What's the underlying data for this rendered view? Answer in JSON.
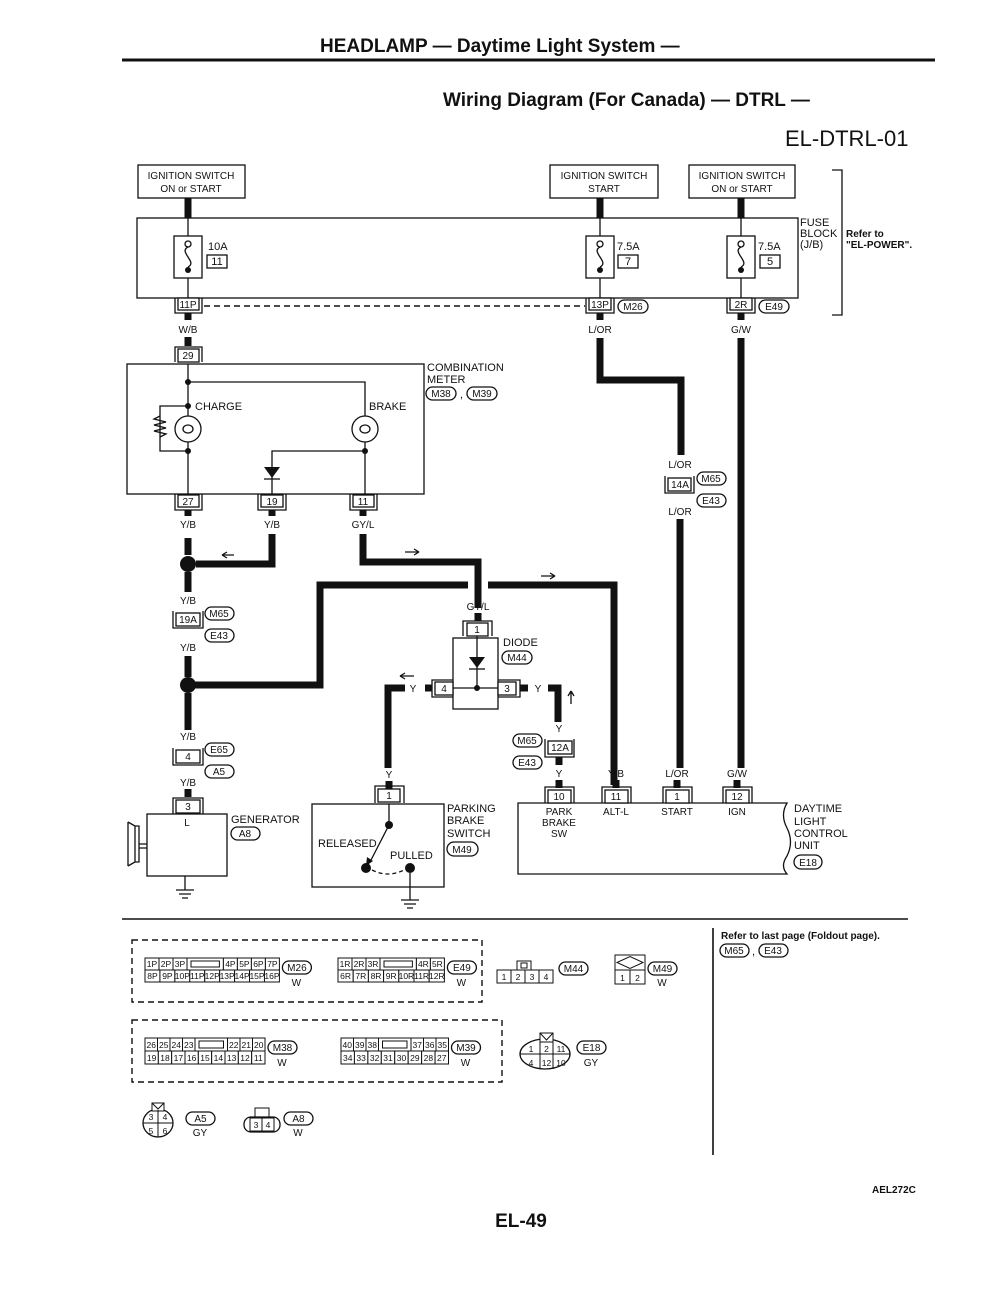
{
  "header": {
    "title": "HEADLAMP — Daytime Light System —",
    "subtitle": "Wiring Diagram (For Canada) — DTRL —",
    "diagram_code": "EL-DTRL-01"
  },
  "power_sources": [
    {
      "line1": "IGNITION SWITCH",
      "line2": "ON or START"
    },
    {
      "line1": "IGNITION SWITCH",
      "line2": "START"
    },
    {
      "line1": "IGNITION SWITCH",
      "line2": "ON or START"
    }
  ],
  "fuse_block": {
    "label_lines": [
      "FUSE",
      "BLOCK",
      "(J/B)"
    ],
    "refer_lines": [
      "Refer to",
      "\"EL-POWER\"."
    ],
    "fuses": [
      {
        "rating": "10A",
        "number": "11",
        "terminal": "11P",
        "connector": "",
        "wire": "W/B"
      },
      {
        "rating": "7.5A",
        "number": "7",
        "terminal": "13P",
        "connector": "M26",
        "wire": "L/OR"
      },
      {
        "rating": "7.5A",
        "number": "5",
        "terminal": "2R",
        "connector": "E49",
        "wire": "G/W"
      }
    ]
  },
  "combination_meter": {
    "label_lines": [
      "COMBINATION",
      "METER"
    ],
    "connectors": [
      "M38",
      "M39"
    ],
    "comma": ",",
    "input_terminal": "29",
    "lamps": [
      "CHARGE",
      "BRAKE"
    ],
    "terminals": [
      {
        "num": "27",
        "wire": "Y/B"
      },
      {
        "num": "19",
        "wire": "Y/B"
      },
      {
        "num": "11",
        "wire": "GY/L"
      }
    ]
  },
  "joint_connectors": {
    "c19a": {
      "terminal": "19A",
      "wire_top": "Y/B",
      "wire_bottom": "Y/B",
      "connectors": [
        "M65",
        "E43"
      ]
    },
    "c14a": {
      "terminal": "14A",
      "wire_top": "L/OR",
      "wire_bottom": "L/OR",
      "connectors": [
        "M65",
        "E43"
      ]
    },
    "c12a": {
      "terminal": "12A",
      "wire_top": "Y",
      "wire_bottom": "Y",
      "connectors": [
        "M65",
        "E43"
      ]
    },
    "c4": {
      "terminal": "4",
      "wire_top": "Y/B",
      "wire_bottom": "Y/B",
      "connectors": [
        "E65",
        "A5"
      ]
    }
  },
  "diode": {
    "label": "DIODE",
    "connector": "M44",
    "wire_in": "GY/L",
    "pins": {
      "top": "1",
      "left": "4",
      "right": "3"
    },
    "wire_left": "Y",
    "wire_right": "Y"
  },
  "generator": {
    "label": "GENERATOR",
    "connector": "A8",
    "terminal": "3",
    "terminal_name": "L"
  },
  "parking_brake_switch": {
    "label_lines": [
      "PARKING",
      "BRAKE",
      "SWITCH"
    ],
    "connector": "M49",
    "terminal": "1",
    "wire": "Y",
    "states": [
      "RELEASED",
      "PULLED"
    ]
  },
  "control_unit": {
    "label_lines": [
      "DAYTIME",
      "LIGHT",
      "CONTROL",
      "UNIT"
    ],
    "connector": "E18",
    "terminals": [
      {
        "num": "10",
        "wire": "Y",
        "name_lines": [
          "PARK",
          "BRAKE",
          "SW"
        ]
      },
      {
        "num": "11",
        "wire": "Y/B",
        "name_lines": [
          "ALT-L"
        ]
      },
      {
        "num": "1",
        "wire": "L/OR",
        "name_lines": [
          "START"
        ]
      },
      {
        "num": "12",
        "wire": "G/W",
        "name_lines": [
          "IGN"
        ]
      }
    ]
  },
  "connector_views": {
    "m26": {
      "id": "M26",
      "color": "W",
      "top": [
        "1P",
        "2P",
        "3P",
        "",
        "4P",
        "5P",
        "6P",
        "7P"
      ],
      "bottom": [
        "8P",
        "9P",
        "10P",
        "11P",
        "12P",
        "13P",
        "14P",
        "15P",
        "16P"
      ]
    },
    "e49": {
      "id": "E49",
      "color": "W",
      "top": [
        "1R",
        "2R",
        "3R",
        "",
        "4R",
        "5R"
      ],
      "bottom": [
        "6R",
        "7R",
        "8R",
        "9R",
        "10R",
        "11R",
        "12R"
      ]
    },
    "m44": {
      "id": "M44",
      "pins": [
        "1",
        "2",
        "3",
        "4"
      ]
    },
    "m49": {
      "id": "M49",
      "color": "W",
      "pins": [
        "1",
        "2"
      ]
    },
    "m38": {
      "id": "M38",
      "color": "W",
      "top": [
        "26",
        "25",
        "24",
        "23",
        "",
        "22",
        "21",
        "20"
      ],
      "bottom": [
        "19",
        "18",
        "17",
        "16",
        "15",
        "14",
        "13",
        "12",
        "11"
      ]
    },
    "m39": {
      "id": "M39",
      "color": "W",
      "top": [
        "40",
        "39",
        "38",
        "",
        "37",
        "36",
        "35"
      ],
      "bottom": [
        "34",
        "33",
        "32",
        "31",
        "30",
        "29",
        "28",
        "27"
      ]
    },
    "e18": {
      "id": "E18",
      "color": "GY",
      "top": [
        "1",
        "2",
        "11"
      ],
      "bottom": [
        "4",
        "12",
        "10"
      ]
    },
    "a5": {
      "id": "A5",
      "color": "GY",
      "top": [
        "3",
        "4"
      ],
      "bottom": [
        "5",
        "6"
      ]
    },
    "a8": {
      "id": "A8",
      "color": "W",
      "pins": [
        "3",
        "4"
      ]
    }
  },
  "foldout_note": {
    "text": "Refer to last page (Foldout page).",
    "connectors": [
      "M65",
      "E43"
    ],
    "comma": ","
  },
  "figure_code": "AEL272C",
  "page_number": "EL-49"
}
